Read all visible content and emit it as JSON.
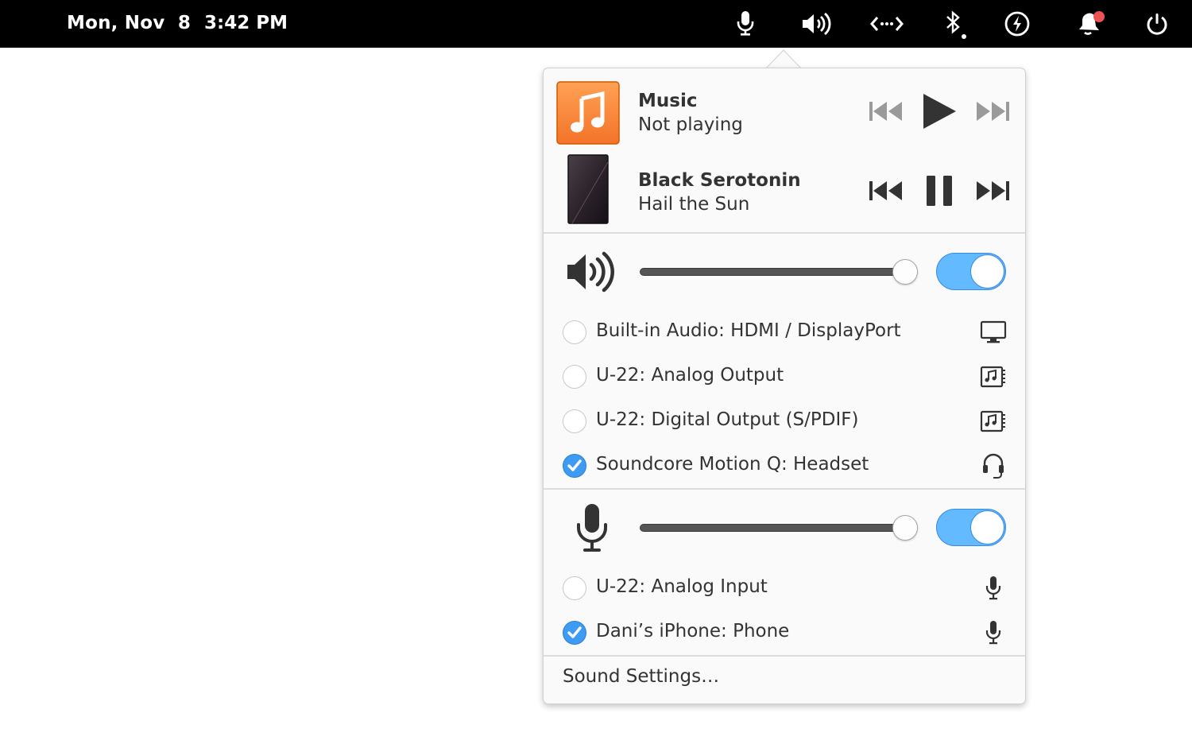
{
  "panel": {
    "date": "Mon, Nov  8",
    "time": "3:42 PM",
    "indicators": [
      "microphone-icon",
      "audio-volume-high-icon",
      "network-wired-icon",
      "bluetooth-icon",
      "power-icon",
      "notification-icon",
      "shutdown-icon"
    ],
    "notification_dot_color": "#ed5353"
  },
  "players": [
    {
      "title": "Music",
      "subtitle": "Not playing",
      "art": "music-app-icon",
      "state": "stopped"
    },
    {
      "title": "Black Serotonin",
      "subtitle": "Hail the Sun",
      "art": "album-art",
      "state": "playing"
    }
  ],
  "output": {
    "volume_percent": 100,
    "enabled": true,
    "devices": [
      {
        "label": "Built-in Audio: HDMI / DisplayPort",
        "icon": "monitor-icon",
        "selected": false
      },
      {
        "label": "U-22: Analog Output",
        "icon": "audio-card-icon",
        "selected": false
      },
      {
        "label": "U-22: Digital Output (S/PDIF)",
        "icon": "audio-card-icon",
        "selected": false
      },
      {
        "label": "Soundcore Motion Q: Headset",
        "icon": "headset-icon",
        "selected": true
      }
    ]
  },
  "input": {
    "volume_percent": 100,
    "enabled": true,
    "devices": [
      {
        "label": "U-22: Analog Input",
        "icon": "microphone-icon",
        "selected": false
      },
      {
        "label": "Dani’s iPhone: Phone",
        "icon": "microphone-icon",
        "selected": true
      }
    ]
  },
  "settings_label": "Sound Settings…",
  "colors": {
    "accent": "#64baff",
    "accent_border": "#3689e6",
    "music_orange": "#f37329",
    "check_blue": "#3d9bf3"
  }
}
